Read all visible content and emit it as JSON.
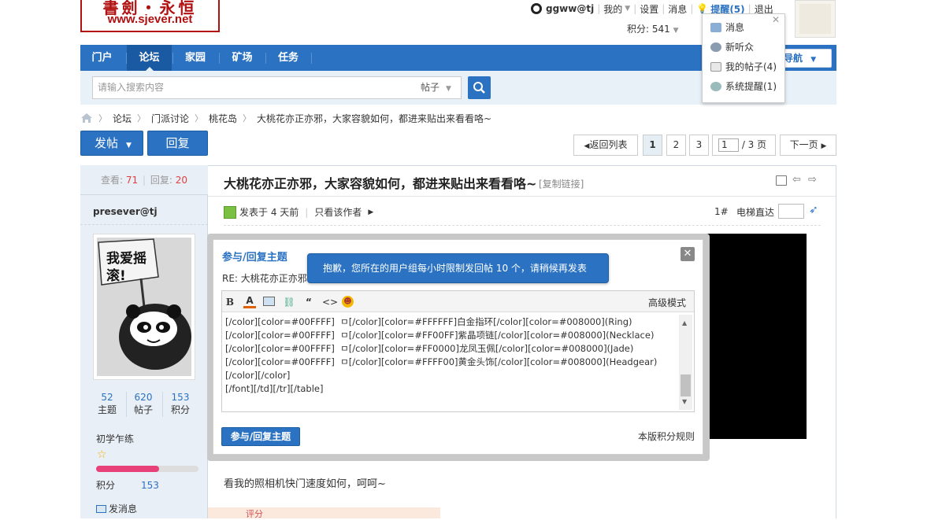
{
  "logo": {
    "line1": "書劍・永恒",
    "line2": "www.sjever.net"
  },
  "topbar": {
    "user": "ggww@tj",
    "mine": "我的",
    "settings": "设置",
    "messages": "消息",
    "alerts": "提醒(5)",
    "logout": "退出"
  },
  "credits": "积分: 541",
  "nav": {
    "items": [
      "门户",
      "论坛",
      "家园",
      "矿场",
      "任务"
    ],
    "guide": "导航"
  },
  "search": {
    "placeholder": "请输入搜索内容",
    "type": "帖子"
  },
  "breadcrumb": [
    "论坛",
    "门派讨论",
    "桃花岛",
    "大桃花亦正亦邪，大家容貌如何，都进来贴出来看看咯~"
  ],
  "actions": {
    "post": "发帖",
    "reply": "回复"
  },
  "pager": {
    "back": "返回列表",
    "pages": [
      "1",
      "2",
      "3"
    ],
    "current": "1",
    "total": "/ 3 页",
    "next": "下一页"
  },
  "side": {
    "views_label": "查看:",
    "views": "71",
    "replies_label": "回复:",
    "replies": "20",
    "username": "presever@tj",
    "stats": [
      {
        "n": "52",
        "l": "主题"
      },
      {
        "n": "620",
        "l": "帖子"
      },
      {
        "n": "153",
        "l": "积分"
      }
    ],
    "rank": "初学乍练",
    "credits_label": "积分",
    "credits": "153",
    "send_msg": "发消息"
  },
  "post": {
    "title": "大桃花亦正亦邪，大家容貌如何，都进来贴出来看看咯~",
    "copy_link": "[复制链接]",
    "posted": "发表于 4 天前",
    "only_author": "只看该作者",
    "floor": "1#",
    "jump": "电梯直达",
    "text": "看我的照相机快门速度如何，呵呵~",
    "rate": "评分"
  },
  "dialog": {
    "title": "参与/回复主题",
    "re": "RE: 大桃花亦正亦邪",
    "tip": "抱歉，您所在的用户组每小时限制发回帖 10 个，请稍候再发表",
    "advanced": "高级模式",
    "content": "[/color][color=#00FFFF]  ㅁ[/color][color=#FFFFFF]白金指环[/color][color=#008000](Ring)\n[/color][color=#00FFFF]  ㅁ[/color][color=#FF00FF]紫晶项链[/color][color=#008000](Necklace)\n[/color][color=#00FFFF]  ㅁ[/color][color=#FF0000]龙凤玉佩[/color][color=#008000](Jade)\n[/color][color=#00FFFF]  ㅁ[/color][color=#FFFF00]黄金头饰[/color][color=#008000](Headgear)\n[/color][/color]\n[/font][/td][/tr][/table]",
    "submit": "参与/回复主题",
    "rules": "本版积分规则"
  },
  "notif": {
    "items": [
      "消息",
      "新听众",
      "我的帖子(4)",
      "系统提醒(1)"
    ]
  }
}
